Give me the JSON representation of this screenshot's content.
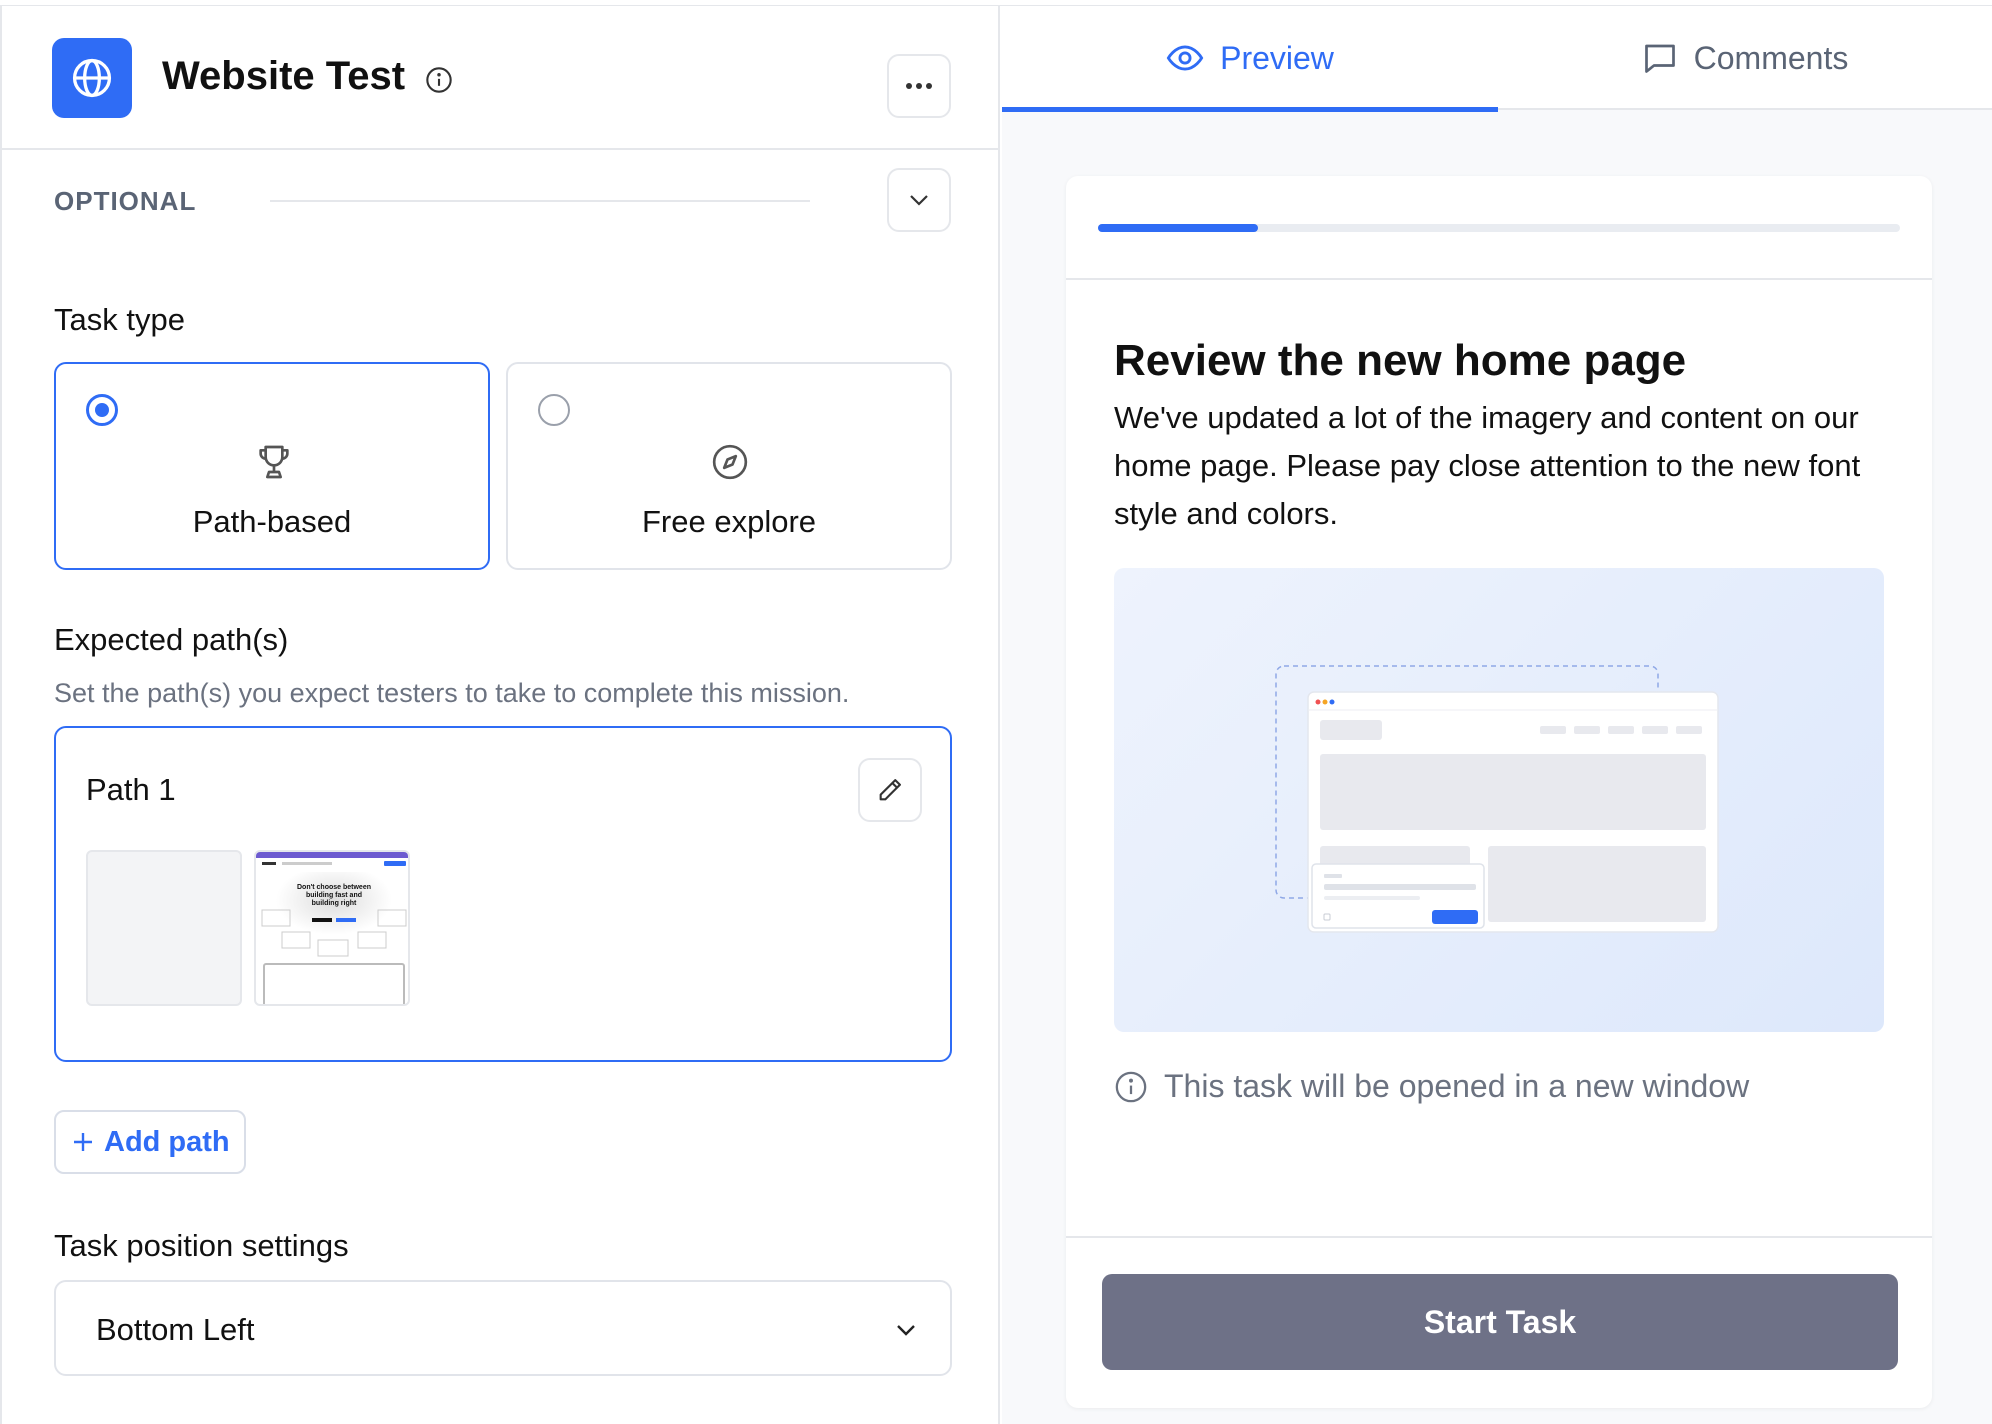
{
  "header": {
    "title": "Website Test"
  },
  "optional": {
    "label": "OPTIONAL"
  },
  "task_type": {
    "label": "Task type",
    "options": [
      {
        "label": "Path-based",
        "icon": "trophy-icon",
        "selected": true
      },
      {
        "label": "Free explore",
        "icon": "compass-icon",
        "selected": false
      }
    ]
  },
  "expected_paths": {
    "label": "Expected path(s)",
    "helper": "Set the path(s) you expect testers to take to complete this mission.",
    "paths": [
      {
        "title": "Path 1",
        "thumb_heading": "Don't choose between building fast and building right"
      }
    ],
    "add_label": "Add path"
  },
  "position": {
    "label": "Task position settings",
    "value": "Bottom Left"
  },
  "tabs": [
    {
      "label": "Preview",
      "icon": "eye-icon",
      "active": true
    },
    {
      "label": "Comments",
      "icon": "comment-icon",
      "active": false
    }
  ],
  "preview": {
    "progress": 0.2,
    "title": "Review the new home page",
    "description": "We've updated a lot of the imagery and content on our home page. Please pay close attention to the new font style and colors.",
    "note": "This task will be opened in a new window",
    "start_label": "Start Task"
  },
  "colors": {
    "accent": "#2f6cf5",
    "button": "#6e7187",
    "muted": "#6b7280"
  }
}
